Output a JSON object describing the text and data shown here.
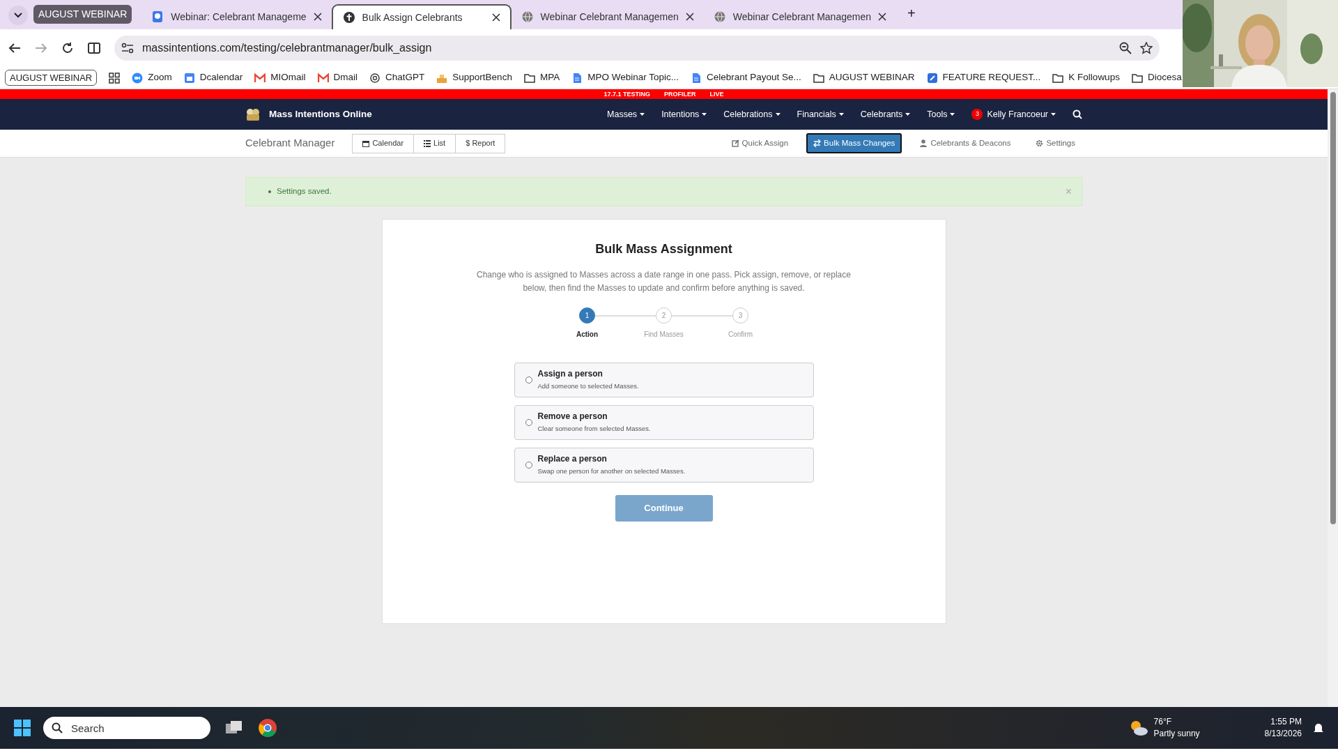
{
  "browser": {
    "tab_group": "AUGUST WEBINAR",
    "tabs": [
      {
        "title": "Webinar: Celebrant Manageme",
        "selected": false
      },
      {
        "title": "Bulk Assign Celebrants",
        "selected": true
      },
      {
        "title": "Webinar Celebrant Managemen",
        "selected": false
      },
      {
        "title": "Webinar Celebrant Managemen",
        "selected": false
      }
    ],
    "new_tab": "+",
    "address": "massintentions.com/testing/celebrantmanager/bulk_assign",
    "bookmarks_group": "AUGUST WEBINAR",
    "bookmarks": [
      {
        "label": "Zoom",
        "kind": "zoom"
      },
      {
        "label": "Dcalendar",
        "kind": "calendar"
      },
      {
        "label": "MIOmail",
        "kind": "mail"
      },
      {
        "label": "Dmail",
        "kind": "mail"
      },
      {
        "label": "ChatGPT",
        "kind": "chat"
      },
      {
        "label": "SupportBench",
        "kind": "bench"
      },
      {
        "label": "MPA",
        "kind": "folder"
      },
      {
        "label": "MPO Webinar Topic...",
        "kind": "doc"
      },
      {
        "label": "Celebrant Payout Se...",
        "kind": "doc"
      },
      {
        "label": "AUGUST WEBINAR",
        "kind": "folder"
      },
      {
        "label": "FEATURE REQUEST...",
        "kind": "app"
      },
      {
        "label": "K Followups",
        "kind": "folder"
      },
      {
        "label": "Diocesa",
        "kind": "folder"
      }
    ]
  },
  "env_bar": [
    "17.7.1 TESTING",
    "PROFILER",
    "LIVE"
  ],
  "navbar": {
    "brand": "Mass Intentions Online",
    "menus": [
      "Masses",
      "Intentions",
      "Celebrations",
      "Financials",
      "Celebrants",
      "Tools"
    ],
    "user_badge": "3",
    "user": "Kelly Francoeur"
  },
  "subnav": {
    "title": "Celebrant Manager",
    "views": [
      {
        "label": "Calendar"
      },
      {
        "label": "List"
      },
      {
        "label": "Report",
        "icon_text": "$"
      }
    ],
    "links": [
      {
        "label": "Quick Assign",
        "selected": false
      },
      {
        "label": "Bulk Mass Changes",
        "selected": true
      },
      {
        "label": "Celebrants & Deacons",
        "selected": false
      },
      {
        "label": "Settings",
        "selected": false
      }
    ]
  },
  "alert": {
    "message": "Settings saved.",
    "close": "×"
  },
  "card": {
    "title": "Bulk Mass Assignment",
    "description": "Change who is assigned to Masses across a date range in one pass. Pick assign, remove, or replace below, then find the Masses to update and confirm before anything is saved.",
    "steps": [
      {
        "number": "1",
        "label": "Action",
        "selected": true
      },
      {
        "number": "2",
        "label": "Find Masses",
        "selected": false
      },
      {
        "number": "3",
        "label": "Confirm",
        "selected": false
      }
    ],
    "options": [
      {
        "title": "Assign a person",
        "description": "Add someone to selected Masses.",
        "selected": false
      },
      {
        "title": "Remove a person",
        "description": "Clear someone from selected Masses.",
        "selected": false
      },
      {
        "title": "Replace a person",
        "description": "Swap one person for another on selected Masses.",
        "selected": false
      }
    ],
    "button": {
      "label": "Continue",
      "disabled": true
    }
  },
  "taskbar": {
    "search_placeholder": "Search",
    "temperature": "76°F",
    "weather": "Partly sunny",
    "time": "1:55 PM",
    "date": "8/13/2026"
  },
  "webcam": {
    "kind": "picture"
  }
}
